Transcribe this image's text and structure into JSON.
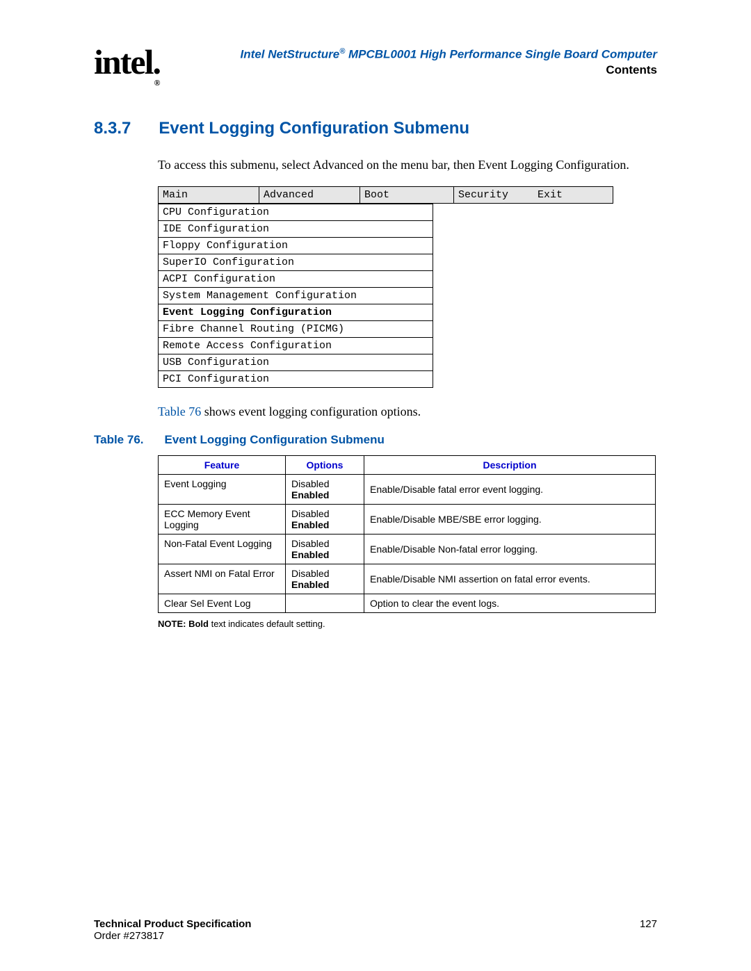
{
  "header": {
    "logo_text": "intel",
    "doc_title_prefix": "Intel NetStructure",
    "doc_title_suffix": " MPCBL0001 High Performance Single Board Computer",
    "contents_label": "Contents"
  },
  "section": {
    "number": "8.3.7",
    "title": "Event Logging Configuration Submenu"
  },
  "intro_text": "To access this submenu, select Advanced on the menu bar, then Event Logging Configuration.",
  "menu_tabs": {
    "main": "Main",
    "advanced": "Advanced",
    "boot": "Boot",
    "security": "Security",
    "exit": "Exit"
  },
  "submenu_items": [
    {
      "label": "CPU Configuration",
      "selected": false
    },
    {
      "label": "IDE Configuration",
      "selected": false
    },
    {
      "label": "Floppy Configuration",
      "selected": false
    },
    {
      "label": "SuperIO Configuration",
      "selected": false
    },
    {
      "label": "ACPI Configuration",
      "selected": false
    },
    {
      "label": "System Management Configuration",
      "selected": false
    },
    {
      "label": "Event Logging Configuration",
      "selected": true
    },
    {
      "label": "Fibre Channel Routing (PICMG)",
      "selected": false
    },
    {
      "label": "Remote Access Configuration",
      "selected": false
    },
    {
      "label": "USB Configuration",
      "selected": false
    },
    {
      "label": "PCI Configuration",
      "selected": false
    }
  ],
  "table_ref_link": "Table 76",
  "table_ref_text": " shows event logging configuration options.",
  "table_caption": {
    "label": "Table 76.",
    "title": "Event Logging Configuration Submenu"
  },
  "feature_headers": {
    "feature": "Feature",
    "options": "Options",
    "description": "Description"
  },
  "feature_rows": [
    {
      "feature": "Event Logging",
      "options": [
        {
          "text": "Disabled",
          "bold": false
        },
        {
          "text": "Enabled",
          "bold": true
        }
      ],
      "description": "Enable/Disable fatal error event logging."
    },
    {
      "feature": "ECC Memory Event Logging",
      "options": [
        {
          "text": "Disabled",
          "bold": false
        },
        {
          "text": "Enabled",
          "bold": true
        }
      ],
      "description": "Enable/Disable MBE/SBE error logging."
    },
    {
      "feature": "Non-Fatal Event Logging",
      "options": [
        {
          "text": "Disabled",
          "bold": false
        },
        {
          "text": "Enabled",
          "bold": true
        }
      ],
      "description": "Enable/Disable Non-fatal error logging."
    },
    {
      "feature": "Assert NMI on Fatal Error",
      "options": [
        {
          "text": "Disabled",
          "bold": false
        },
        {
          "text": "Enabled",
          "bold": true
        }
      ],
      "description": "Enable/Disable NMI assertion on fatal error events."
    },
    {
      "feature": "Clear Sel Event Log",
      "options": [],
      "description": "Option to clear the event logs."
    }
  ],
  "note": {
    "prefix": "NOTE:",
    "bold_word": "Bold",
    "suffix": " text indicates default setting."
  },
  "footer": {
    "spec_label": "Technical Product Specification",
    "order_label": "Order #273817",
    "page_number": "127"
  }
}
